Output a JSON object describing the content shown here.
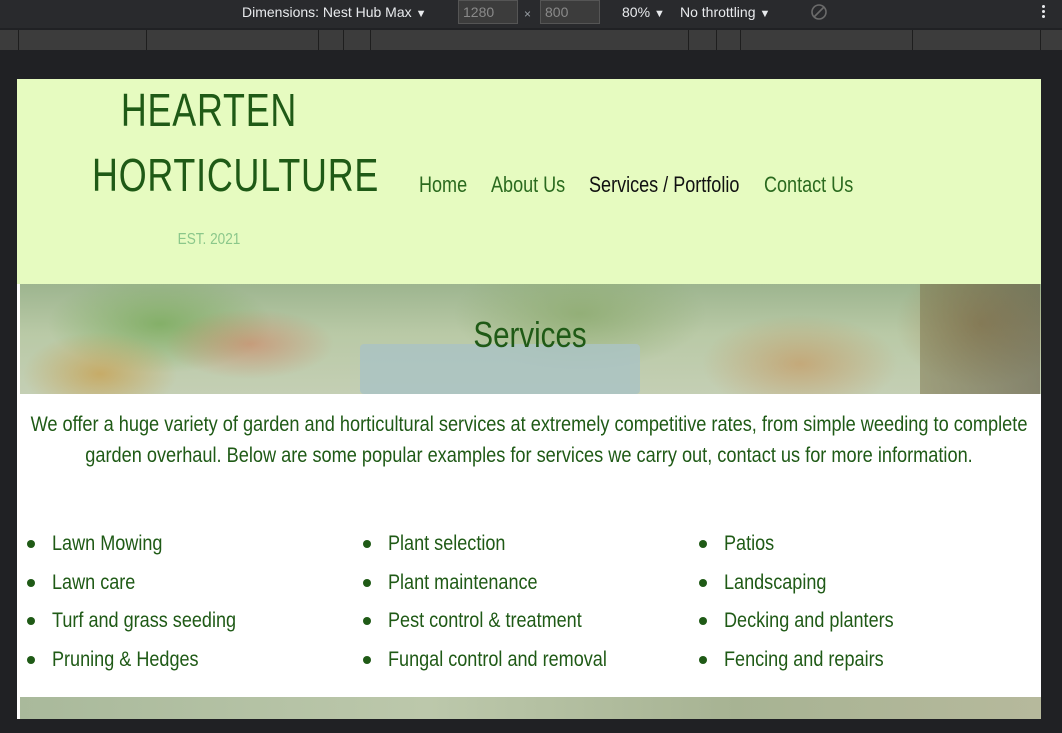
{
  "devtools": {
    "dimensions_label": "Dimensions: Nest Hub Max",
    "width_value": "1280",
    "height_value": "800",
    "times_symbol": "×",
    "zoom": "80%",
    "throttling": "No throttling",
    "caret": "▼"
  },
  "site": {
    "logo_line1": "HEARTEN",
    "logo_line2": "HORTICULTURE",
    "est": "EST. 2021",
    "nav": [
      "Home",
      "About Us",
      "Services / Portfolio",
      "Contact Us"
    ],
    "active_nav_index": 2,
    "heading": "Services",
    "intro": "We offer a huge variety of garden and horticultural services at extremely competitive rates, from simple weeding to complete garden overhaul. Below are some popular examples for services we carry out, contact us for more information.",
    "services": [
      [
        "Lawn Mowing",
        "Lawn care",
        "Turf and grass seeding",
        "Pruning & Hedges"
      ],
      [
        "Plant selection",
        "Plant maintenance",
        "Pest control & treatment",
        "Fungal control and removal"
      ],
      [
        "Patios",
        "Landscaping",
        "Decking and planters",
        "Fencing and repairs"
      ]
    ]
  },
  "colors": {
    "header_bg": "#e6fbc0",
    "brand_green": "#1f5a16",
    "est_green": "#8bc78a",
    "devtools_bg": "#292a2d"
  },
  "icons": {
    "rotate": "rotate-disabled-icon",
    "more": "kebab-menu-icon"
  }
}
